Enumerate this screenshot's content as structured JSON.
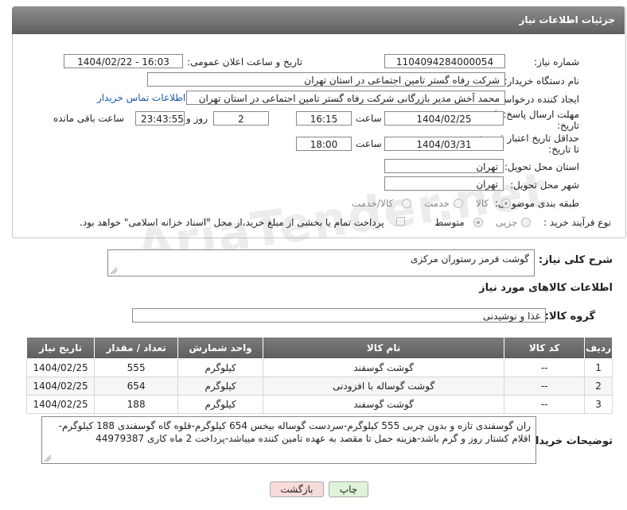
{
  "header": {
    "title": "جزئیات اطلاعات نیاز"
  },
  "form": {
    "need_number": {
      "label": "شماره نیاز:",
      "value": "1104094284000054"
    },
    "announce": {
      "label": "تاریخ و ساعت اعلان عمومی:",
      "value": "1404/02/22 - 16:03"
    },
    "buyer_org": {
      "label": "نام دستگاه خریدار:",
      "value": "شرکت رفاه گستر تامین اجتماعی در استان تهران"
    },
    "creator": {
      "label": "ایجاد کننده درخواست:",
      "value": "محمد آخش مدیر بازرگانی شرکت رفاه گستر تامین اجتماعی در استان تهران",
      "link": "اطلاعات تماس خریدار"
    },
    "deadline": {
      "label": "مهلت ارسال پاسخ: تا تاریخ:",
      "date": "1404/02/25",
      "time_label": "ساعت",
      "time": "16:15",
      "days": "2",
      "days_label": "روز و",
      "remaining": "23:43:55",
      "remaining_label": "ساعت باقی مانده"
    },
    "validity": {
      "label": "حداقل تاریخ اعتبار قیمت: تا تاریخ:",
      "date": "1404/03/31",
      "time_label": "ساعت",
      "time": "18:00"
    },
    "province": {
      "label": "استان محل تحویل:",
      "value": "تهران"
    },
    "city": {
      "label": "شهر محل تحویل:",
      "value": "تهران"
    },
    "category": {
      "label": "طبقه بندی موضوعی:",
      "options": [
        "کالا",
        "خدمت",
        "کالا/خدمت"
      ]
    },
    "process": {
      "label": "نوع فرآیند خرید :",
      "options": [
        "جزیی",
        "متوسط"
      ],
      "payment_note": "پرداخت تمام یا بخشی از مبلغ خرید،از محل \"اسناد خزانه اسلامی\" خواهد بود."
    }
  },
  "summary": {
    "label": "شرح کلی نیاز:",
    "value": "گوشت قرمز رستوران مرکزی"
  },
  "goods_section": {
    "title": "اطلاعات کالاهای مورد نیاز"
  },
  "goods_group": {
    "label": "گروه کالا:",
    "value": "غذا و نوشیدنی"
  },
  "table": {
    "headers": [
      "ردیف",
      "کد کالا",
      "نام کالا",
      "واحد شمارش",
      "تعداد / مقدار",
      "تاریخ نیاز"
    ],
    "rows": [
      [
        "1",
        "--",
        "گوشت گوسفند",
        "کیلوگرم",
        "555",
        "1404/02/25"
      ],
      [
        "2",
        "--",
        "گوشت گوساله با افزودنی",
        "کیلوگرم",
        "654",
        "1404/02/25"
      ],
      [
        "3",
        "--",
        "گوشت گوسفند",
        "کیلوگرم",
        "188",
        "1404/02/25"
      ]
    ]
  },
  "buyer_notes": {
    "label": "توضیحات خریدار:",
    "value": "ران گوسفندی تازه و بدون چربی 555 کیلوگرم-سردست گوساله بیخس 654 کیلوگرم-قلوه گاه گوسفندی 188 کیلوگرم-اقلام کشتار روز و گرم باشد-هزینه حمل تا مقصد به عهده تامین کننده میباشد-پرداخت 2 ماه کاری 44979387"
  },
  "buttons": {
    "print": "چاپ",
    "back": "بازگشت"
  },
  "watermark": "AriaTender.net",
  "colors": {
    "header": "#6f6f6f",
    "back_button": "#f7dada",
    "print_button": "#dff3d6",
    "link": "#1a5aa8"
  }
}
